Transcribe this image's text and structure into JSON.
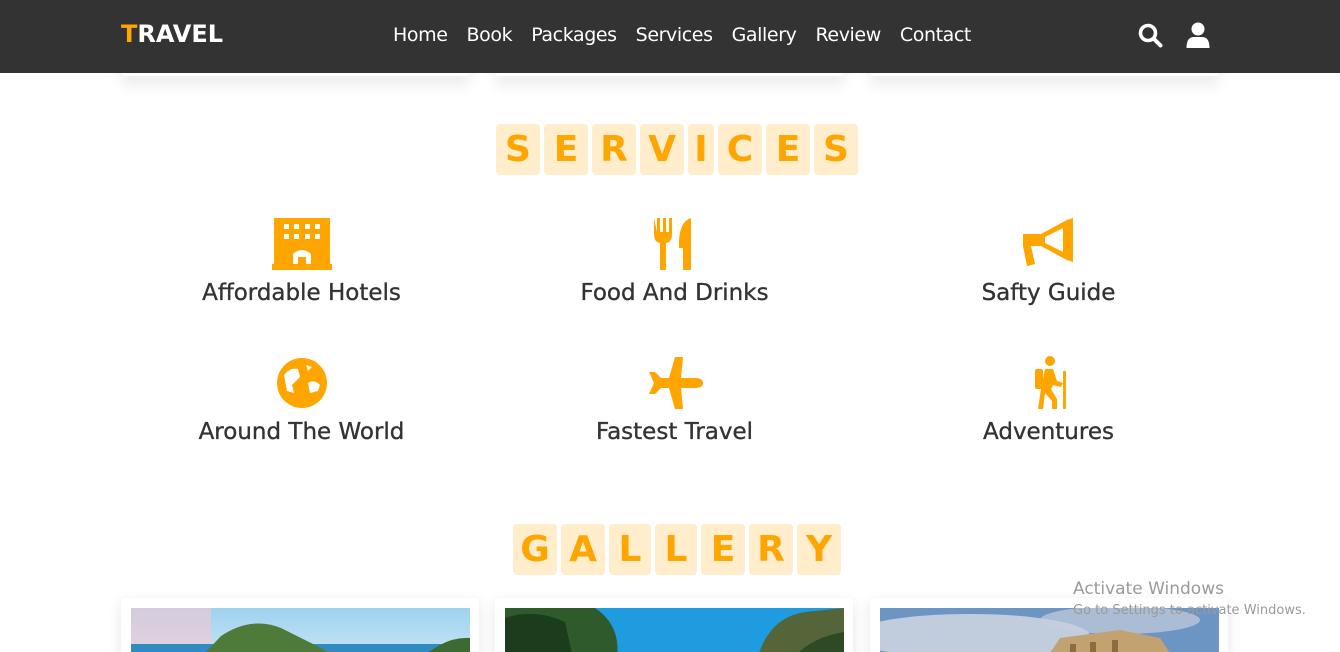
{
  "header": {
    "logo_first": "T",
    "logo_rest": "RAVEL",
    "nav": [
      "Home",
      "Book",
      "Packages",
      "Services",
      "Gallery",
      "Review",
      "Contact"
    ],
    "icons": [
      "search-icon",
      "user-icon"
    ]
  },
  "services": {
    "heading": [
      "S",
      "E",
      "R",
      "V",
      "I",
      "C",
      "E",
      "S"
    ],
    "items": [
      {
        "icon": "hotel-icon",
        "title": "Affordable Hotels"
      },
      {
        "icon": "utensils-icon",
        "title": "Food And Drinks"
      },
      {
        "icon": "bullhorn-icon",
        "title": "Safty Guide"
      },
      {
        "icon": "globe-icon",
        "title": "Around The World"
      },
      {
        "icon": "plane-icon",
        "title": "Fastest Travel"
      },
      {
        "icon": "hiking-icon",
        "title": "Adventures"
      }
    ]
  },
  "gallery": {
    "heading": [
      "G",
      "A",
      "L",
      "L",
      "E",
      "R",
      "Y"
    ]
  },
  "watermark": {
    "title": "Activate Windows",
    "subtitle": "Go to Settings to activate Windows."
  },
  "colors": {
    "accent": "#ffa500",
    "accent_light": "#ffedcc",
    "header_bg": "#333333",
    "text": "#333333"
  }
}
